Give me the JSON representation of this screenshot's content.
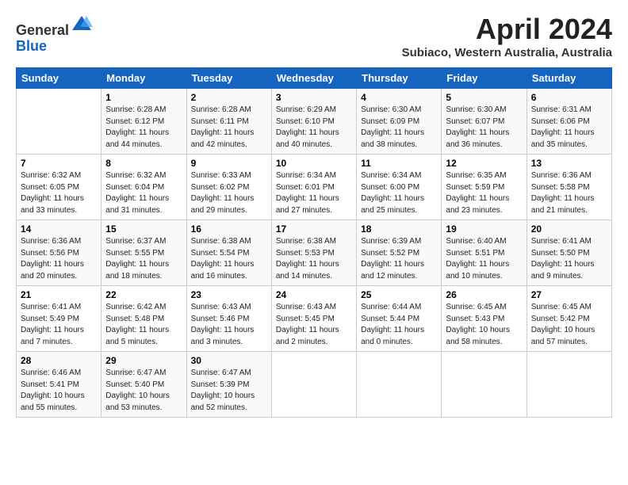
{
  "header": {
    "logo_line1": "General",
    "logo_line2": "Blue",
    "month_title": "April 2024",
    "subtitle": "Subiaco, Western Australia, Australia"
  },
  "weekdays": [
    "Sunday",
    "Monday",
    "Tuesday",
    "Wednesday",
    "Thursday",
    "Friday",
    "Saturday"
  ],
  "weeks": [
    [
      {
        "day": "",
        "info": ""
      },
      {
        "day": "1",
        "info": "Sunrise: 6:28 AM\nSunset: 6:12 PM\nDaylight: 11 hours\nand 44 minutes."
      },
      {
        "day": "2",
        "info": "Sunrise: 6:28 AM\nSunset: 6:11 PM\nDaylight: 11 hours\nand 42 minutes."
      },
      {
        "day": "3",
        "info": "Sunrise: 6:29 AM\nSunset: 6:10 PM\nDaylight: 11 hours\nand 40 minutes."
      },
      {
        "day": "4",
        "info": "Sunrise: 6:30 AM\nSunset: 6:09 PM\nDaylight: 11 hours\nand 38 minutes."
      },
      {
        "day": "5",
        "info": "Sunrise: 6:30 AM\nSunset: 6:07 PM\nDaylight: 11 hours\nand 36 minutes."
      },
      {
        "day": "6",
        "info": "Sunrise: 6:31 AM\nSunset: 6:06 PM\nDaylight: 11 hours\nand 35 minutes."
      }
    ],
    [
      {
        "day": "7",
        "info": "Sunrise: 6:32 AM\nSunset: 6:05 PM\nDaylight: 11 hours\nand 33 minutes."
      },
      {
        "day": "8",
        "info": "Sunrise: 6:32 AM\nSunset: 6:04 PM\nDaylight: 11 hours\nand 31 minutes."
      },
      {
        "day": "9",
        "info": "Sunrise: 6:33 AM\nSunset: 6:02 PM\nDaylight: 11 hours\nand 29 minutes."
      },
      {
        "day": "10",
        "info": "Sunrise: 6:34 AM\nSunset: 6:01 PM\nDaylight: 11 hours\nand 27 minutes."
      },
      {
        "day": "11",
        "info": "Sunrise: 6:34 AM\nSunset: 6:00 PM\nDaylight: 11 hours\nand 25 minutes."
      },
      {
        "day": "12",
        "info": "Sunrise: 6:35 AM\nSunset: 5:59 PM\nDaylight: 11 hours\nand 23 minutes."
      },
      {
        "day": "13",
        "info": "Sunrise: 6:36 AM\nSunset: 5:58 PM\nDaylight: 11 hours\nand 21 minutes."
      }
    ],
    [
      {
        "day": "14",
        "info": "Sunrise: 6:36 AM\nSunset: 5:56 PM\nDaylight: 11 hours\nand 20 minutes."
      },
      {
        "day": "15",
        "info": "Sunrise: 6:37 AM\nSunset: 5:55 PM\nDaylight: 11 hours\nand 18 minutes."
      },
      {
        "day": "16",
        "info": "Sunrise: 6:38 AM\nSunset: 5:54 PM\nDaylight: 11 hours\nand 16 minutes."
      },
      {
        "day": "17",
        "info": "Sunrise: 6:38 AM\nSunset: 5:53 PM\nDaylight: 11 hours\nand 14 minutes."
      },
      {
        "day": "18",
        "info": "Sunrise: 6:39 AM\nSunset: 5:52 PM\nDaylight: 11 hours\nand 12 minutes."
      },
      {
        "day": "19",
        "info": "Sunrise: 6:40 AM\nSunset: 5:51 PM\nDaylight: 11 hours\nand 10 minutes."
      },
      {
        "day": "20",
        "info": "Sunrise: 6:41 AM\nSunset: 5:50 PM\nDaylight: 11 hours\nand 9 minutes."
      }
    ],
    [
      {
        "day": "21",
        "info": "Sunrise: 6:41 AM\nSunset: 5:49 PM\nDaylight: 11 hours\nand 7 minutes."
      },
      {
        "day": "22",
        "info": "Sunrise: 6:42 AM\nSunset: 5:48 PM\nDaylight: 11 hours\nand 5 minutes."
      },
      {
        "day": "23",
        "info": "Sunrise: 6:43 AM\nSunset: 5:46 PM\nDaylight: 11 hours\nand 3 minutes."
      },
      {
        "day": "24",
        "info": "Sunrise: 6:43 AM\nSunset: 5:45 PM\nDaylight: 11 hours\nand 2 minutes."
      },
      {
        "day": "25",
        "info": "Sunrise: 6:44 AM\nSunset: 5:44 PM\nDaylight: 11 hours\nand 0 minutes."
      },
      {
        "day": "26",
        "info": "Sunrise: 6:45 AM\nSunset: 5:43 PM\nDaylight: 10 hours\nand 58 minutes."
      },
      {
        "day": "27",
        "info": "Sunrise: 6:45 AM\nSunset: 5:42 PM\nDaylight: 10 hours\nand 57 minutes."
      }
    ],
    [
      {
        "day": "28",
        "info": "Sunrise: 6:46 AM\nSunset: 5:41 PM\nDaylight: 10 hours\nand 55 minutes."
      },
      {
        "day": "29",
        "info": "Sunrise: 6:47 AM\nSunset: 5:40 PM\nDaylight: 10 hours\nand 53 minutes."
      },
      {
        "day": "30",
        "info": "Sunrise: 6:47 AM\nSunset: 5:39 PM\nDaylight: 10 hours\nand 52 minutes."
      },
      {
        "day": "",
        "info": ""
      },
      {
        "day": "",
        "info": ""
      },
      {
        "day": "",
        "info": ""
      },
      {
        "day": "",
        "info": ""
      }
    ]
  ]
}
